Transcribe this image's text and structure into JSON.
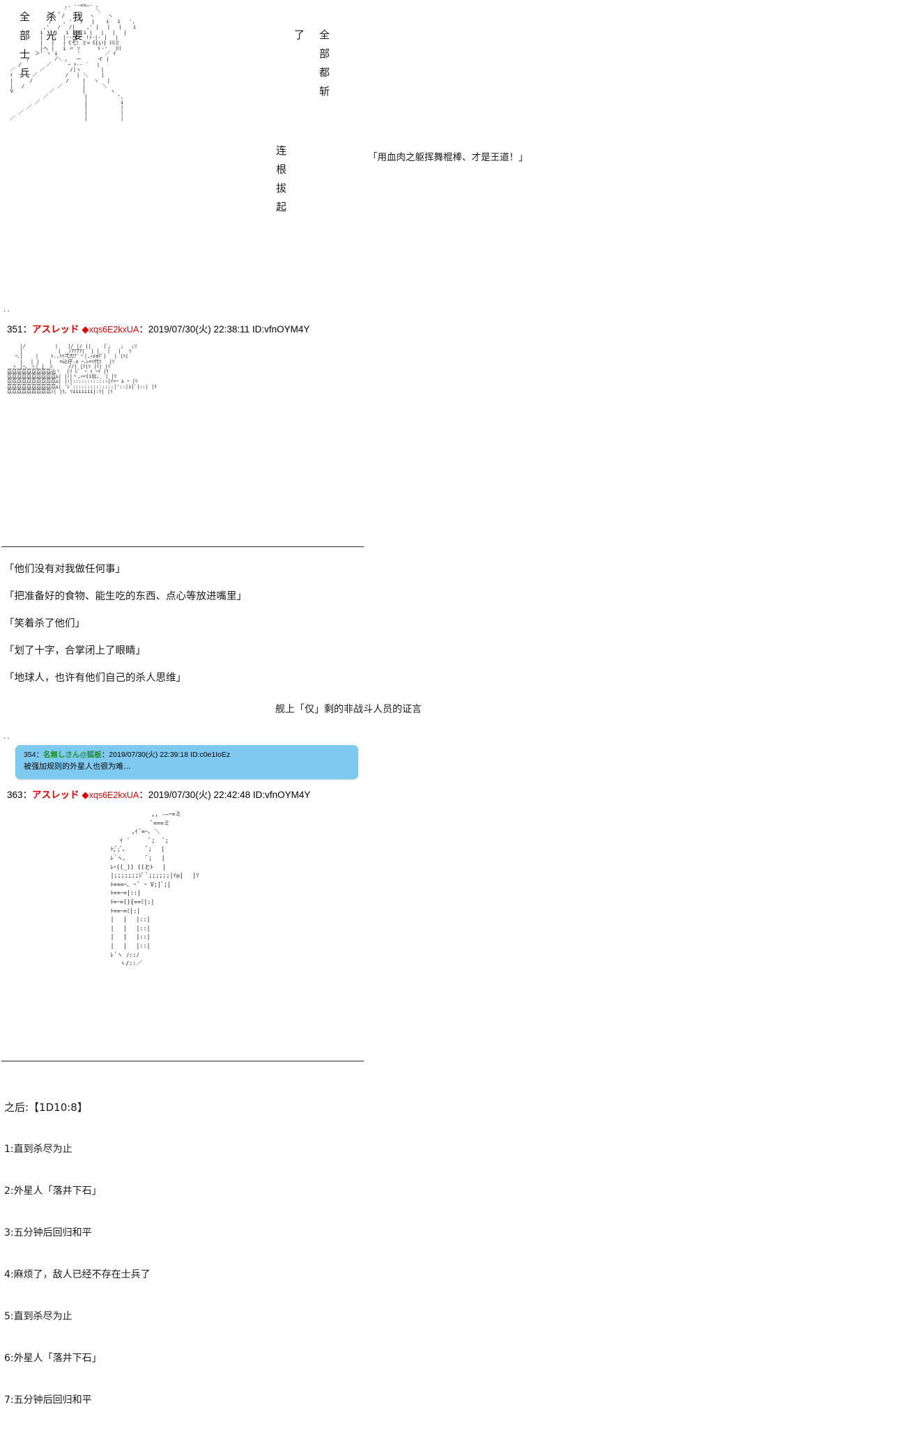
{
  "page": {
    "board_style": "2ch-aa-thread",
    "background": "#ffffff",
    "name_color": "#dd0000",
    "anon_name_color": "#1f8f1f",
    "highlight_bg": "#7ec9f0"
  },
  "vertical_texts": {
    "left_col_1": "我要",
    "left_col_2": "杀光",
    "left_col_3": "全部士兵",
    "mid_col_1": "了",
    "mid_col_2": "全部都斩",
    "mid_col_3": "连根拔起"
  },
  "top_quote": "「用血肉之躯挥舞棍棒、才是王道！」",
  "aa_top": " 　　　　　　　　　　 ,. -‐==―- 、\n 　　　　　　　 　 , ´　　　　　 ＼\n 　　　　 　 　 /　 /　 　 　 ヽ　 　ヽ\n 　 　 　 　 　,'　 , '　 /　 | 　 i 　i　 ',\n 　 　 　 　 ,'　 /　 /| 　 ,' |　 |　 | 　 i\n 　 　 　 　i 　 i　 i |　 i |　 |　 |　 |\n 　 　 　 　|　 |　 |-‐ｧ|　 !ｧ‐|‐ |　 |\n 　 　 　 　|　 |　 |《弋ﾐ ミ=《{い} 川ミ\n 　 　 　 　|ヘ |　 i 〃 ｿ　 　 ゞ-'　 川\n 　 　 　 ＞'´ヽ i 　 　 '　 　 　 ／ ｲ\n 　 　 /　 　 　 ﾉ＼ 、　 ー　 　 イ |\n 　 /　 　 　 ／ 　 ｀ｰ ｧ-‐ ´　 |\n ／　 　 　 ／　 　 　 /|ヽ 　 　 |\n ｲ 　 　 ／ 　 　 　 /　 | ＼　 　|\n |　 　 /　 　 　 　 /　 　|　 ヽ 　|\n |　 /　 　 　 　 ／ 　 　 |　 　 ＼\n V 　 　 　 　 ／ 　 　 　 |　 　 　 ヽ\n 　 　 　 　 ／ 　 　 　 　 |　 　 　 　',\n 　 　 　 ／ 　 　 　 　 　 |　 　 　 　 i\n 　 　 ／ 　 　 　 　 　 　 |　 　 　 　 |\n 　 ／ 　 　 　 　 　 　 　 |　 　 　 　 |\n ／ 　 　 　 　 　 　 　 　 |　 　 　 　 |\n",
  "post_351": {
    "number": "351",
    "sep": "：",
    "name": "アスレッド",
    "diamond": "◆",
    "trip": "xqs6E2kxUA",
    "date": "2019/07/30(火) 22:38:11",
    "id": "ID:vfnOYM4Y"
  },
  "aa_351": " 　　 |/　　　　　　|　　|/ |/ ||　　 }ﾞ;　　;　 ;ﾘ\n 　　 |　　　　　 　 |　 ﾉ7ｱ7ｱ|  | |　 |　 |　 ﾘ\n 　 ｰ､|　　 |　　 ﾄ.,ｲｲ弌刃ｱ`丶|,ｨzaｸﾞ|　 | |ﾊ|\n 　　 |　 | |　　|　 n込仔.∨ ｰ､ﾚ=ｲ代ﾂ　 |ﾘ\n 　ヽ |ｰ､ ヽ| |  ﾊ 　　 //| |ﾘ|ﾘ |ﾘ| |ﾘ\n 苡苡苡苡苡苡苡苡苡込丶  |ﾘ ﾚﾞ｀ｰ ｲ ｰｲ |ﾘ\n 苡苡苡苡苡苡苡苡苡苡ﾑ| |ﾉ|丶,ｨ<{i出,_ | |ﾘ\n 苡苡苡苡苡苡苡苡苡苡ﾑ| |ﾉ|::::::::::::|ｲ<ｰ ﾑ ｰ |ﾘ\n 苡苡苡苡苡苡苡苡苡苡ﾑ| 'ﾚ´::::::::::::::|'::|i|ﾞ|::| |ﾘ\n 苡苡苡苡苡苡苡苡苡ﾉ| |ﾘ､ ﾘiiiiiii|:ﾘ| |ﾘ\n",
  "dialogue_block": {
    "lines": [
      "「他们没有对我做任何事」",
      "「把准备好的食物、能生吃的东西、点心等放进嘴里」",
      "「笑着杀了他们」",
      "「划了十字，合掌闭上了眼睛」",
      "「地球人，也许有他们自己的杀人思维」"
    ],
    "caption": "舰上「仅」剩的非战斗人员的证言"
  },
  "post_354": {
    "number": "354",
    "sep": "：",
    "name": "名無しさん@狐板",
    "date": "2019/07/30(火) 22:39:18",
    "id": "ID:c0e1IoEz",
    "body": "被强加规则的外星人也很为难..."
  },
  "post_363": {
    "number": "363",
    "sep": "：",
    "name": "アスレッド",
    "diamond": "◆",
    "trip": "xqs6E2kxUA",
    "date": "2019/07/30(火) 22:42:48",
    "id": "ID:vfnOYM4Y"
  },
  "aa_363": " 　　　　　　　　 ,, -―ｰ=ミ\n 　　　　　 　 　 ﾞ===ミ\n 　　　 　 ,ｲ´=ｰ､ ＼\n 　 　 ｲ ´　　　 ﾞ;　 ﾞ;\n 　 ﾄ;ﾞ;ﾞ､ 　 　 ﾞ;　 |\n 　 ﾚ´ヽ､ 　 　 ﾞ; 　|\n 　 ﾚｰ((_)) ((とﾄ 　|\n 　 |;;;;;;;ｼﾞ ﾞ;;;;;;|ｲ◎| 　|ﾘ\n 　 ﾄ===ｰ､ ｰ ﾞ ｰ V;|ﾞ;|\n 　 ﾄ==ｰ=|::|\n 　 ﾄ=ｰ=(){==ﾐ|:|\n 　 ﾄ==ｰ=ﾐ|:|\n 　 |　 |　 |::|\n 　 |　 |　 |::|\n 　 |　 |　 |::|\n 　 |　 |　 |::|\n 　 ﾚ´ヽ ﾉ::ﾉ\n 　 　 ヽ/::／\n",
  "dice": {
    "title": "之后:【1D10:8】",
    "options": [
      "1:直到杀尽为止",
      "2:外星人「落井下石」",
      "3:五分钟后回归和平",
      "4:麻烦了，敌人已经不存在士兵了",
      "5:直到杀尽为止",
      "6:外星人「落井下石」",
      "7:五分钟后回归和平"
    ]
  }
}
